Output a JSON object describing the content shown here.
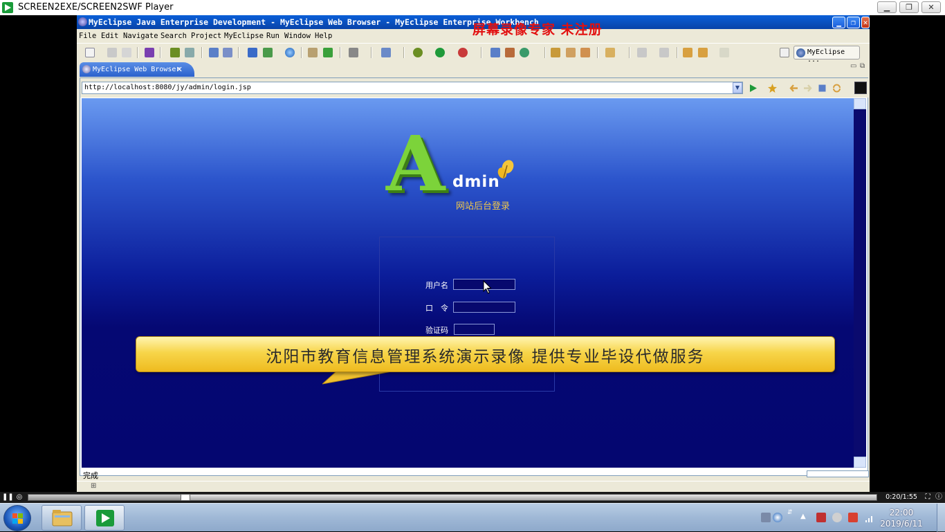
{
  "player": {
    "title": "SCREEN2EXE/SCREEN2SWF Player",
    "timecode": "0:20/1:55",
    "progress": 0.185
  },
  "eclipse": {
    "title": "MyEclipse Java Enterprise Development - MyEclipse Web Browser - MyEclipse Enterprise Workbench",
    "watermark": "屏幕录像专家 未注册",
    "menus": [
      "File",
      "Edit",
      "Navigate",
      "Search",
      "Project",
      "MyEclipse",
      "Run",
      "Window",
      "Help"
    ],
    "perspective": "MyEclipse ...",
    "tab_label": "MyEclipse Web Browser",
    "tab_close": "✕",
    "url": "http://localhost:8080/jy/admin/login.jsp",
    "status": "完成"
  },
  "webpage": {
    "logo_big": "A",
    "logo_small": "dmin",
    "subtitle": "网站后台登录",
    "username_label": "用户名",
    "password_label": "口　令",
    "captcha_label": "验证码"
  },
  "callout": {
    "text": "沈阳市教育信息管理系统演示录像  提供专业毕设代做服务"
  },
  "taskbar": {
    "time": "22:00",
    "date": "2019/6/11"
  },
  "colors": {
    "accent": "#0a5fd8",
    "page_top": "#6a9af0",
    "page_bottom": "#040670",
    "logo_green": "#7cd33a",
    "subtitle_gold": "#f1c84a",
    "watermark_red": "#e21010"
  }
}
